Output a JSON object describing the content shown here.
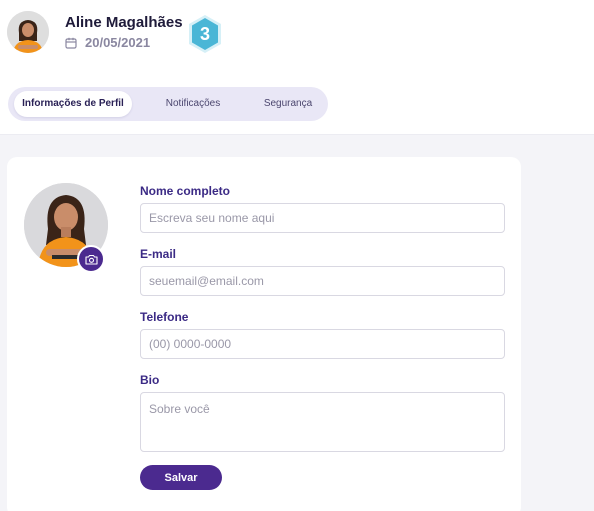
{
  "user": {
    "name": "Aline Magalhães",
    "date": "20/05/2021",
    "level": "3"
  },
  "tabs": [
    {
      "label": "Informações de Perfil",
      "active": true
    },
    {
      "label": "Notificações",
      "active": false
    },
    {
      "label": "Segurança",
      "active": false
    }
  ],
  "form": {
    "name_label": "Nome completo",
    "name_placeholder": "Escreva seu nome aqui",
    "email_label": "E-mail",
    "email_placeholder": "seuemail@email.com",
    "phone_label": "Telefone",
    "phone_placeholder": "(00) 0000-0000",
    "bio_label": "Bio",
    "bio_placeholder": "Sobre você",
    "save_label": "Salvar"
  },
  "icons": {
    "calendar": "calendar-icon",
    "camera": "camera-icon",
    "badge": "hexagon-level-badge"
  },
  "colors": {
    "primary": "#4b2a8f",
    "label": "#3b2a85",
    "badge": "#4ab6d6",
    "tabs_bg": "#e9e7f6",
    "page_bg": "#f4f4f8"
  }
}
